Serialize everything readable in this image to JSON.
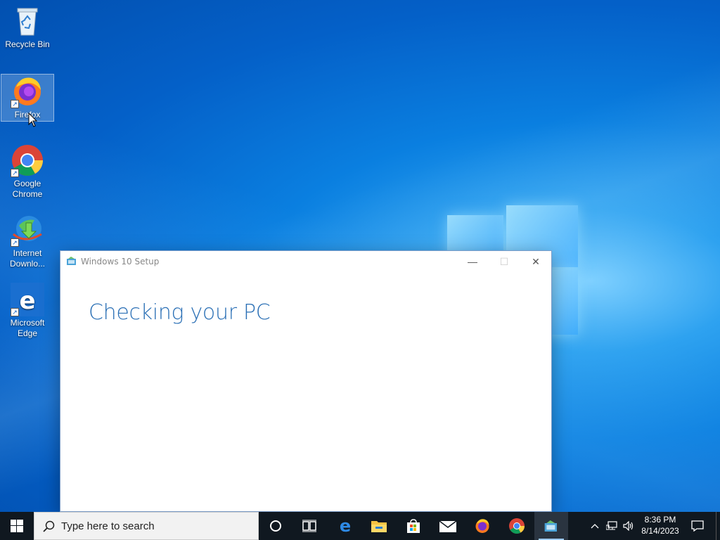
{
  "desktop": {
    "icons": [
      {
        "label": "Recycle Bin",
        "icon": "recycle-bin-icon"
      },
      {
        "label": "Firefox",
        "icon": "firefox-icon",
        "selected": true
      },
      {
        "label": "Google Chrome",
        "icon": "chrome-icon"
      },
      {
        "label": "Internet Downlo...",
        "icon": "internet-download-manager-icon"
      },
      {
        "label": "Microsoft Edge",
        "icon": "edge-icon"
      }
    ]
  },
  "setup_window": {
    "title": "Windows 10 Setup",
    "heading": "Checking your PC",
    "controls": {
      "minimize": "—",
      "maximize": "☐",
      "close": "✕"
    }
  },
  "taskbar": {
    "search_placeholder": "Type here to search",
    "apps": [
      "cortana-icon",
      "task-view-icon",
      "edge-icon",
      "file-explorer-icon",
      "store-icon",
      "mail-icon",
      "firefox-icon",
      "chrome-icon",
      "windows-setup-icon"
    ],
    "clock": {
      "time": "8:36 PM",
      "date": "8/14/2023"
    }
  },
  "colors": {
    "taskbar": "#101820",
    "heading": "#2a6fb5",
    "desktop_accent": "#0a7fe0"
  }
}
